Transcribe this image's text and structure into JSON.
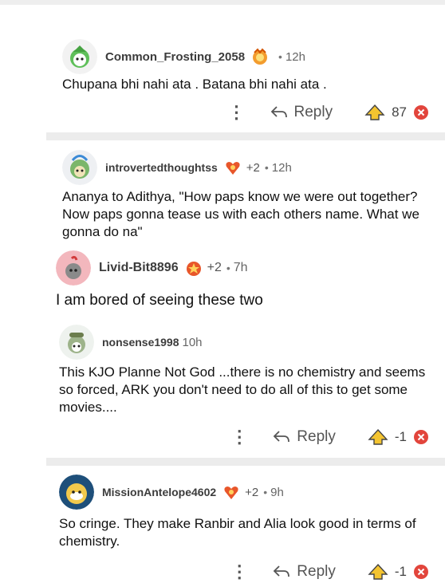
{
  "comments": [
    {
      "username": "Common_Frosting_2058",
      "plus": "",
      "dot": "•",
      "time": "12h",
      "body": "Chupana bhi nahi ata . Batana bhi nahi ata .",
      "reply_label": "Reply",
      "score": "87"
    },
    {
      "username": "introvertedthoughtss",
      "plus": "+2",
      "dot": "•",
      "time": "12h",
      "body": "Ananya to Adithya, \"How paps know we were out together? Now paps gonna tease us with each others name. What we gonna do na\""
    },
    {
      "username": "Livid-Bit8896",
      "plus": "+2",
      "dot": "•",
      "time": "7h",
      "body": "I am bored of seeing these two"
    },
    {
      "username": "nonsense1998",
      "plus": "",
      "dot": "",
      "time": "10h",
      "body": "This KJO Planne Not God ...there is no chemistry and seems so forced, ARK you don't need to do all of this to get some movies....",
      "reply_label": "Reply",
      "score": "-1"
    },
    {
      "username": "MissionAntelope4602",
      "plus": "+2",
      "dot": "•",
      "time": "9h",
      "body": "So cringe. They make Ranbir and Alia look good in terms of chemistry.",
      "reply_label": "Reply",
      "score": "-1"
    }
  ],
  "icons": {
    "more": "more-options-icon",
    "reply": "reply-arrow-icon",
    "upvote": "upvote-arrow-icon",
    "downvote": "downvote-icon",
    "award": "award-icon"
  },
  "colors": {
    "upvote": "#f4c430",
    "downvote": "#e2453c",
    "separator": "#ececec"
  }
}
